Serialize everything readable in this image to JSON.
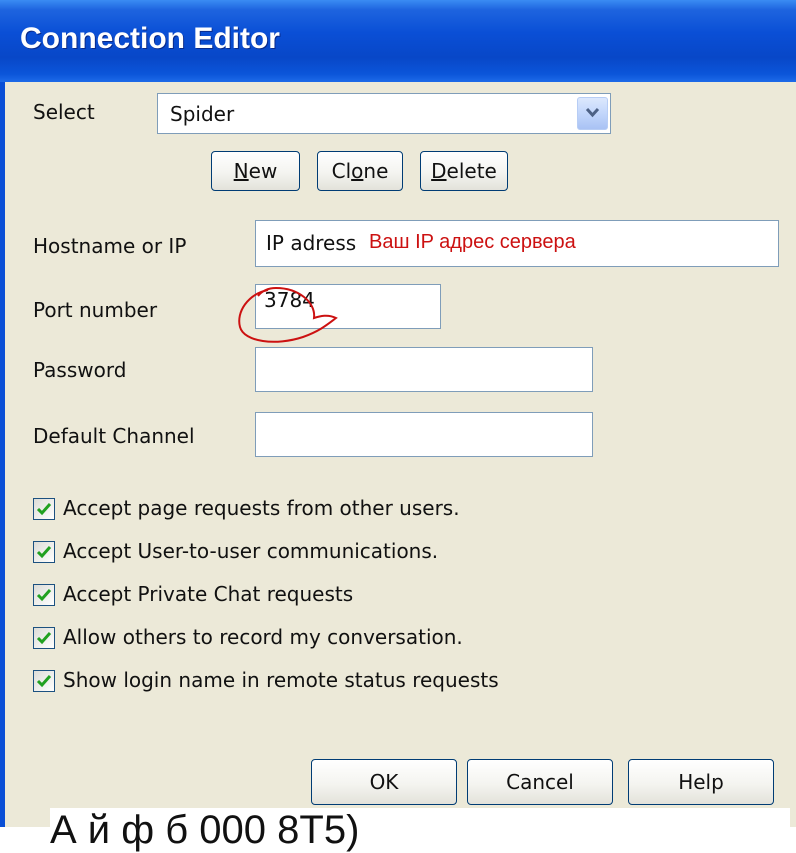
{
  "window": {
    "title": "Connection Editor"
  },
  "form": {
    "select_label": "Select",
    "select_value": "Spider",
    "buttons": {
      "new": "New",
      "clone": "Clone",
      "delete": "Delete"
    },
    "hostname_label": "Hostname or IP",
    "hostname_value": "IP adress",
    "hostname_annotation": "Ваш IP адрес сервера",
    "port_label": "Port number",
    "port_value": "3784",
    "password_label": "Password",
    "password_value": "",
    "channel_label": "Default Channel",
    "channel_value": ""
  },
  "options": [
    {
      "label": "Accept page requests from other users.",
      "checked": true
    },
    {
      "label": "Accept User-to-user communications.",
      "checked": true
    },
    {
      "label": "Accept Private Chat requests",
      "checked": true
    },
    {
      "label": "Allow others to record my conversation.",
      "checked": true
    },
    {
      "label": "Show login name in remote status requests",
      "checked": true
    }
  ],
  "footer": {
    "ok": "OK",
    "cancel": "Cancel",
    "help": "Help"
  },
  "caption": "А                         й   ф   б   000    8Т5)",
  "colors": {
    "title_blue": "#0A4FD6",
    "dialog_bg": "#ECE9D8",
    "annotation_red": "#CC1111",
    "check_green": "#21A121"
  }
}
